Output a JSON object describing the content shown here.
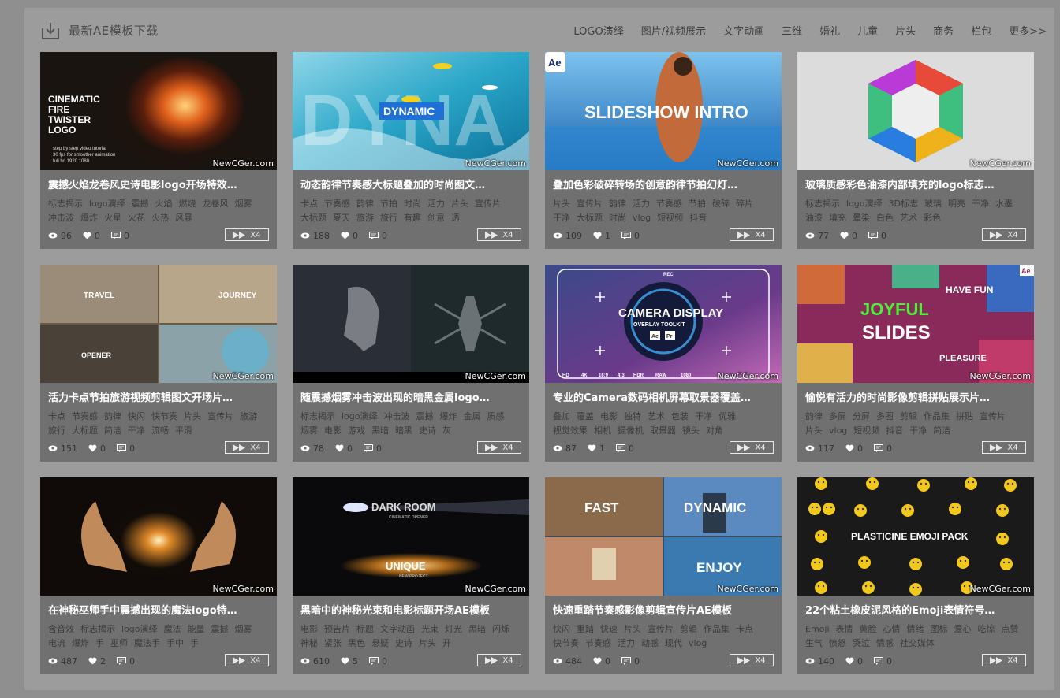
{
  "header": {
    "title": "最新AE模板下载",
    "icon": "download-icon",
    "nav": [
      "LOGO演绎",
      "图片/视频展示",
      "文字动画",
      "三维",
      "婚礼",
      "儿童",
      "片头",
      "商务",
      "栏包",
      "更多>>"
    ]
  },
  "watermark": "NewCGer.com",
  "preview_label": "X4",
  "cards": [
    {
      "title": "震撼火焰龙卷风史诗电影logo开场特效…",
      "tags": [
        "标志揭示",
        "logo演绎",
        "震撼",
        "火焰",
        "燃烧",
        "龙卷风",
        "烟雾",
        "冲击波",
        "爆炸",
        "火星",
        "火花",
        "火热",
        "风暴"
      ],
      "views": "96",
      "likes": "0",
      "comments": "0",
      "thumb_text": [
        "CINEMATIC",
        "FIRE",
        "TWISTER",
        "LOGO"
      ],
      "thumb_sub": [
        "step by step video tutorial",
        "30 fps for smoother animation",
        "full hd 1920.1080"
      ]
    },
    {
      "title": "动态韵律节奏感大标题叠加的时尚图文…",
      "tags": [
        "卡点",
        "节奏感",
        "韵律",
        "节拍",
        "时尚",
        "活力",
        "片头",
        "宣传片",
        "大标题",
        "夏天",
        "旅游",
        "旅行",
        "有趣",
        "创意",
        "透"
      ],
      "views": "188",
      "likes": "0",
      "comments": "0",
      "thumb_text": [
        "DYNA",
        "DYNAMIC"
      ]
    },
    {
      "title": "叠加色彩破碎转场的创意韵律节拍幻灯…",
      "tags": [
        "片头",
        "宣传片",
        "韵律",
        "活力",
        "节奏感",
        "节拍",
        "破碎",
        "碎片",
        "干净",
        "大标题",
        "时尚",
        "vlog",
        "短视频",
        "抖音"
      ],
      "views": "109",
      "likes": "1",
      "comments": "0",
      "thumb_text": [
        "SLIDESHOW INTRO",
        "Ae"
      ]
    },
    {
      "title": "玻璃质感彩色油漆内部填充的logo标志…",
      "tags": [
        "标志揭示",
        "logo演绎",
        "3D标志",
        "玻璃",
        "明亮",
        "干净",
        "水墨",
        "油漆",
        "填充",
        "晕染",
        "白色",
        "艺术",
        "彩色"
      ],
      "views": "77",
      "likes": "0",
      "comments": "0"
    },
    {
      "title": "活力卡点节拍旅游视频剪辑图文开场片…",
      "tags": [
        "卡点",
        "节奏感",
        "韵律",
        "快闪",
        "快节奏",
        "片头",
        "宣传片",
        "旅游",
        "旅行",
        "大标题",
        "简洁",
        "干净",
        "流畅",
        "平滑"
      ],
      "views": "151",
      "likes": "0",
      "comments": "0",
      "thumb_text": [
        "TRAVEL",
        "JOURNEY",
        "OPENER"
      ]
    },
    {
      "title": "随震撼烟雾冲击波出现的暗黑金属logo…",
      "tags": [
        "标志揭示",
        "logo演绎",
        "冲击波",
        "震撼",
        "爆炸",
        "金属",
        "质感",
        "烟雾",
        "电影",
        "游戏",
        "黑暗",
        "暗黑",
        "史诗",
        "灰"
      ],
      "views": "78",
      "likes": "0",
      "comments": "0"
    },
    {
      "title": "专业的Camera数码相机屏幕取景器覆盖…",
      "tags": [
        "叠加",
        "覆盖",
        "电影",
        "独特",
        "艺术",
        "包装",
        "干净",
        "优雅",
        "视觉效果",
        "相机",
        "摄像机",
        "取景器",
        "镜头",
        "对角"
      ],
      "views": "87",
      "likes": "1",
      "comments": "0",
      "thumb_text": [
        "CAMERA DISPLAY",
        "OVERLAY TOOLKIT",
        "Ae",
        "Pr",
        "REC",
        "HD",
        "4K",
        "16:9",
        "4:3",
        "HDR",
        "RAW",
        "1080"
      ]
    },
    {
      "title": "愉悦有活力的时尚影像剪辑拼贴展示片…",
      "tags": [
        "韵律",
        "多屏",
        "分屏",
        "多图",
        "剪辑",
        "作品集",
        "拼贴",
        "宣传片",
        "片头",
        "vlog",
        "短视频",
        "抖音",
        "干净",
        "简洁"
      ],
      "views": "117",
      "likes": "0",
      "comments": "0",
      "thumb_text": [
        "JOYFUL",
        "SLIDES",
        "HAVE FUN",
        "PLEASURE",
        "Ae"
      ]
    },
    {
      "title": "在神秘巫师手中震撼出现的魔法logo特…",
      "tags": [
        "含音效",
        "标志揭示",
        "logo演绎",
        "魔法",
        "能量",
        "震撼",
        "烟雾",
        "电流",
        "爆炸",
        "手",
        "巫师",
        "魔法手",
        "手中",
        "手"
      ],
      "views": "487",
      "likes": "2",
      "comments": "0"
    },
    {
      "title": "黑暗中的神秘光束和电影标题开场AE模板",
      "tags": [
        "电影",
        "预告片",
        "标题",
        "文字动画",
        "光束",
        "灯光",
        "黑暗",
        "闪烁",
        "神秘",
        "紧张",
        "黑色",
        "悬疑",
        "史诗",
        "片头",
        "开"
      ],
      "views": "610",
      "likes": "5",
      "comments": "0",
      "thumb_text": [
        "DARK ROOM",
        "CINEMATIC OPENER",
        "UNIQUE",
        "NEW PROJECT"
      ]
    },
    {
      "title": "快速重踏节奏感影像剪辑宣传片AE模板",
      "tags": [
        "快闪",
        "重踏",
        "快速",
        "片头",
        "宣传片",
        "剪辑",
        "作品集",
        "卡点",
        "快节奏",
        "节奏感",
        "活力",
        "动感",
        "现代",
        "vlog"
      ],
      "views": "484",
      "likes": "0",
      "comments": "0",
      "thumb_text": [
        "FAST",
        "DYNAMIC",
        "ENJOY"
      ]
    },
    {
      "title": "22个粘土橡皮泥风格的Emoji表情符号…",
      "tags": [
        "Emoji",
        "表情",
        "黄脸",
        "心情",
        "情绪",
        "图标",
        "爱心",
        "吃惊",
        "点赞",
        "生气",
        "愤怒",
        "哭泣",
        "情感",
        "社交媒体"
      ],
      "views": "140",
      "likes": "0",
      "comments": "0",
      "thumb_text": [
        "PLASTICINE EMOJI PACK"
      ]
    }
  ]
}
